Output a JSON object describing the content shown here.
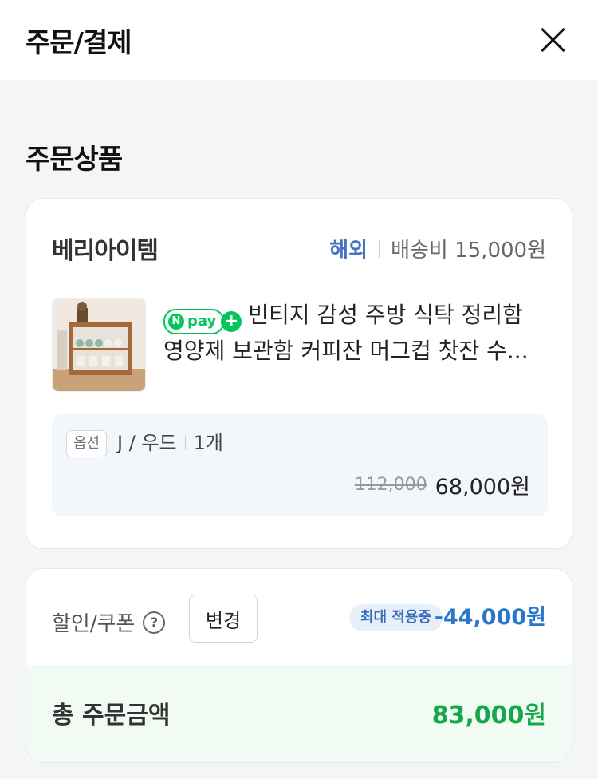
{
  "header": {
    "title": "주문/결제",
    "close_icon": "close-icon"
  },
  "section": {
    "title": "주문상품"
  },
  "order": {
    "seller": "베리아이템",
    "overseas": "해외",
    "shipping": "배송비 15,000원",
    "npay_label": "pay",
    "product_line1": "빈티지 감성 주방 식탁 정리함",
    "product_line2": "영양제 보관함 커피잔 머그컵 찻잔 수...",
    "option_tag": "옵션",
    "option_value": "J / 우드",
    "quantity": "1개",
    "original_price": "112,000",
    "sale_price": "68,000원"
  },
  "discount": {
    "label": "할인/쿠폰",
    "change_label": "변경",
    "max_badge": "최대 적용중",
    "amount": "-44,000원"
  },
  "total": {
    "label": "총 주문금액",
    "amount": "83,000원"
  },
  "colors": {
    "npay_green": "#03c75a",
    "discount_blue": "#2a76c9",
    "total_green": "#14a84a"
  }
}
